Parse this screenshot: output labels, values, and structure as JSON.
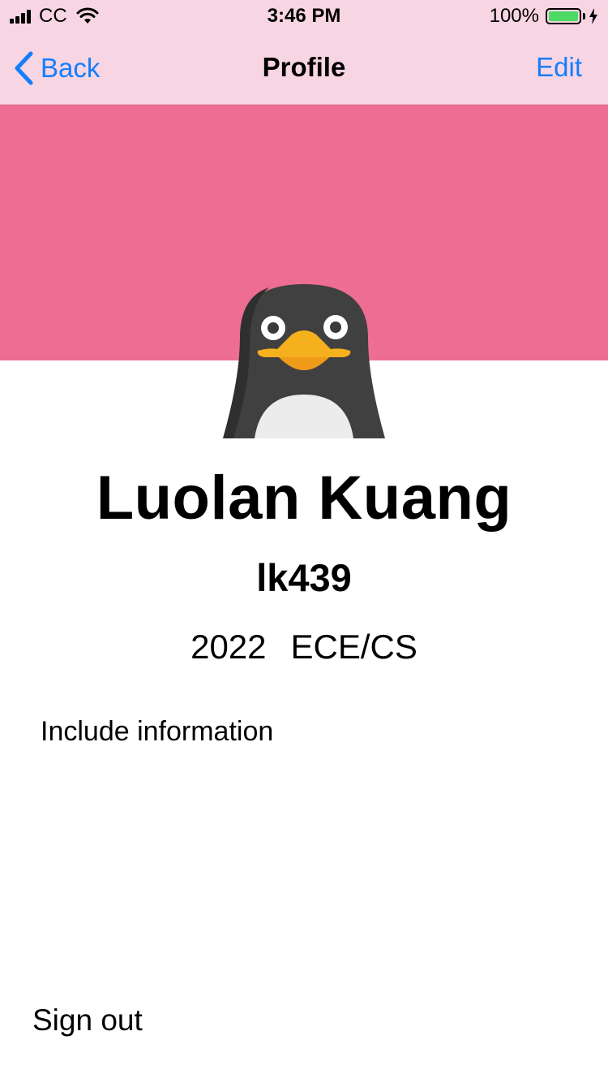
{
  "status_bar": {
    "carrier": "CC",
    "time": "3:46 PM",
    "battery_percent": "100%",
    "battery_level": 1.0,
    "battery_color": "#4cd964"
  },
  "nav": {
    "back_label": "Back",
    "title": "Profile",
    "edit_label": "Edit",
    "accent_color": "#147efb"
  },
  "header": {
    "banner_color": "#ee6d93",
    "avatar_icon": "penguin-icon"
  },
  "profile": {
    "name": "Luolan Kuang",
    "netid": "lk439",
    "year": "2022",
    "major": "ECE/CS",
    "include_label": "Include information"
  },
  "actions": {
    "sign_out_label": "Sign out"
  }
}
